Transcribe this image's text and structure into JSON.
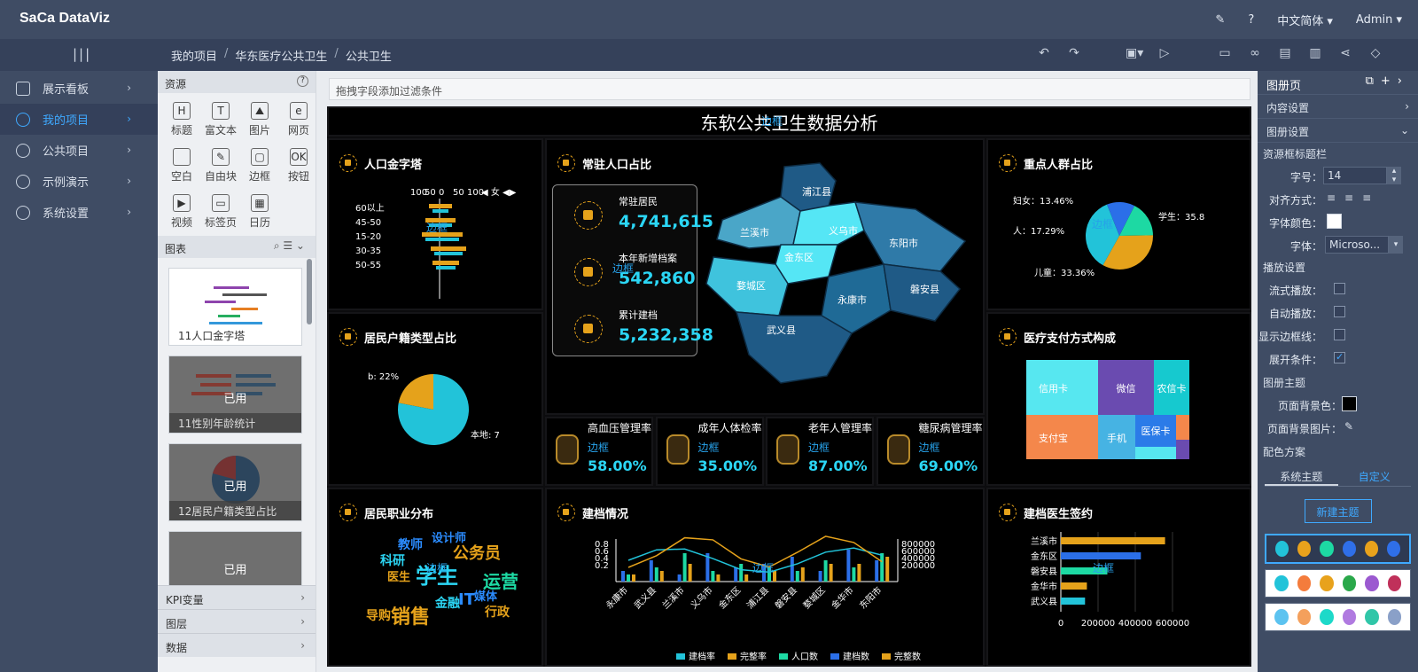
{
  "app": {
    "logo": "SaCa DataViz"
  },
  "top": {
    "lang": "中文简体 ▾",
    "user": "Admin ▾"
  },
  "breadcrumb": [
    "我的项目",
    "华东医疗公共卫生",
    "公共卫生"
  ],
  "nav": [
    {
      "label": "展示看板"
    },
    {
      "label": "我的项目"
    },
    {
      "label": "公共项目"
    },
    {
      "label": "示例演示"
    },
    {
      "label": "系统设置"
    }
  ],
  "resources": {
    "title": "资源",
    "items": [
      {
        "icon": "H",
        "label": "标题"
      },
      {
        "icon": "T",
        "label": "富文本"
      },
      {
        "icon": "⛰",
        "label": "图片"
      },
      {
        "icon": "e",
        "label": "网页"
      },
      {
        "icon": "",
        "label": "空白"
      },
      {
        "icon": "✎",
        "label": "自由块"
      },
      {
        "icon": "▢",
        "label": "边框"
      },
      {
        "icon": "OK",
        "label": "按钮"
      },
      {
        "icon": "▶",
        "label": "视频"
      },
      {
        "icon": "▭",
        "label": "标签页"
      },
      {
        "icon": "▦",
        "label": "日历"
      }
    ],
    "chart_section": "图表",
    "thumbs": [
      {
        "caption": "11人口金字塔",
        "used": ""
      },
      {
        "caption": "11性别年龄统计",
        "used": "已用"
      },
      {
        "caption": "12居民户籍类型占比",
        "used": "已用"
      },
      {
        "caption": "",
        "used": "已用"
      }
    ],
    "lower": [
      "KPI变量",
      "图层",
      "数据"
    ]
  },
  "filter_placeholder": "拖拽字段添加过滤条件",
  "dashboard": {
    "title": "东软公共卫生数据分析",
    "edge": "边框",
    "panels": {
      "pyramid": "人口金字塔",
      "resident": "常驻人口占比",
      "key_group": "重点人群占比",
      "household": "居民户籍类型占比",
      "payment": "医疗支付方式构成",
      "occupation": "居民职业分布",
      "records": "建档情况",
      "doctor": "建档医生签约"
    },
    "kpis": [
      {
        "label": "常驻居民",
        "value": "4,741,615"
      },
      {
        "label": "本年新增档案",
        "value": "542,860"
      },
      {
        "label": "累计建档",
        "value": "5,232,358"
      }
    ],
    "rates": [
      {
        "label": "高血压管理率",
        "value": "58.00%"
      },
      {
        "label": "成年人体检率",
        "value": "35.00%"
      },
      {
        "label": "老年人管理率",
        "value": "87.00%"
      },
      {
        "label": "糖尿病管理率",
        "value": "69.00%"
      }
    ],
    "map_regions": [
      "浦江县",
      "兰溪市",
      "义乌市",
      "金东区",
      "东阳市",
      "婺城区",
      "永康市",
      "磐安县",
      "武义县"
    ],
    "payment_cells": [
      "信用卡",
      "微信",
      "农信卡",
      "支付宝",
      "手机",
      "医保卡"
    ],
    "words": [
      "教师",
      "设计师",
      "科研",
      "公务员",
      "医生",
      "学生",
      "运营",
      "媒体",
      "金融",
      "IT",
      "导购",
      "销售",
      "行政"
    ]
  },
  "chart_data": [
    {
      "type": "bar",
      "title": "人口金字塔",
      "categories": [
        "60以上",
        "45-50",
        "15-20",
        "30-35",
        "50-55"
      ],
      "xticks": [
        "100",
        "50",
        "0",
        "50",
        "100"
      ],
      "legend": [
        "女"
      ]
    },
    {
      "type": "pie",
      "title": "重点人群占比",
      "labels": [
        "妇女：13.46%",
        "人：17.29%",
        "儿童：33.36%",
        "学生：35.8"
      ],
      "values": [
        13.46,
        17.29,
        33.36,
        35.89
      ]
    },
    {
      "type": "pie",
      "title": "居民户籍类型占比",
      "labels": [
        "b: 22%",
        "本地: 7"
      ],
      "values": [
        22,
        78
      ]
    },
    {
      "type": "bar",
      "title": "建档情况",
      "categories": [
        "永康市",
        "武义县",
        "兰溪市",
        "义乌市",
        "金东区",
        "浦江县",
        "磐安县",
        "婺城区",
        "金华市",
        "东阳市"
      ],
      "yticks_left": [
        "0.8",
        "0.6",
        "0.4",
        "0.2"
      ],
      "yticks_right": [
        "800000",
        "600000",
        "400000",
        "200000"
      ],
      "legend": [
        "建档率",
        "完整率",
        "人口数",
        "建档数",
        "完整数"
      ]
    },
    {
      "type": "bar",
      "title": "建档医生签约",
      "categories": [
        "兰溪市",
        "金东区",
        "磐安县",
        "金华市",
        "武义县"
      ],
      "values": [
        560000,
        430000,
        250000,
        140000,
        130000
      ],
      "xticks": [
        "0",
        "200000",
        "400000",
        "600000"
      ]
    }
  ],
  "right_panel": {
    "title": "图册页",
    "sections": [
      "内容设置",
      "图册设置"
    ],
    "sub": "资源框标题栏",
    "font_size_label": "字号：",
    "font_size": "14",
    "align_label": "对齐方式：",
    "font_color_label": "字体颜色：",
    "font_label": "字体：",
    "font": "Microso...",
    "play": "播放设置",
    "checks": [
      {
        "label": "流式播放：",
        "checked": false
      },
      {
        "label": "自动播放：",
        "checked": false
      },
      {
        "label": "显示边框线：",
        "checked": false
      },
      {
        "label": "展开条件：",
        "checked": true
      }
    ],
    "theme": "图册主题",
    "bg_color": "页面背景色：",
    "bg_image": "页面背景图片：",
    "scheme": "配色方案",
    "tabs": [
      "系统主题",
      "自定义"
    ],
    "new_theme": "新建主题",
    "palettes": [
      [
        "#22c3d9",
        "#e8a21c",
        "#1dd9a3",
        "#2f6fe8",
        "#e8a21c",
        "#2f6fe8"
      ],
      [
        "#22c3d9",
        "#f47c3c",
        "#e8a21c",
        "#2aa84a",
        "#9b59d0",
        "#c0305a"
      ],
      [
        "#5cc3f0",
        "#f4a05c",
        "#1dd9c9",
        "#b07ae0",
        "#30c6a8",
        "#8aa0c8"
      ]
    ]
  }
}
